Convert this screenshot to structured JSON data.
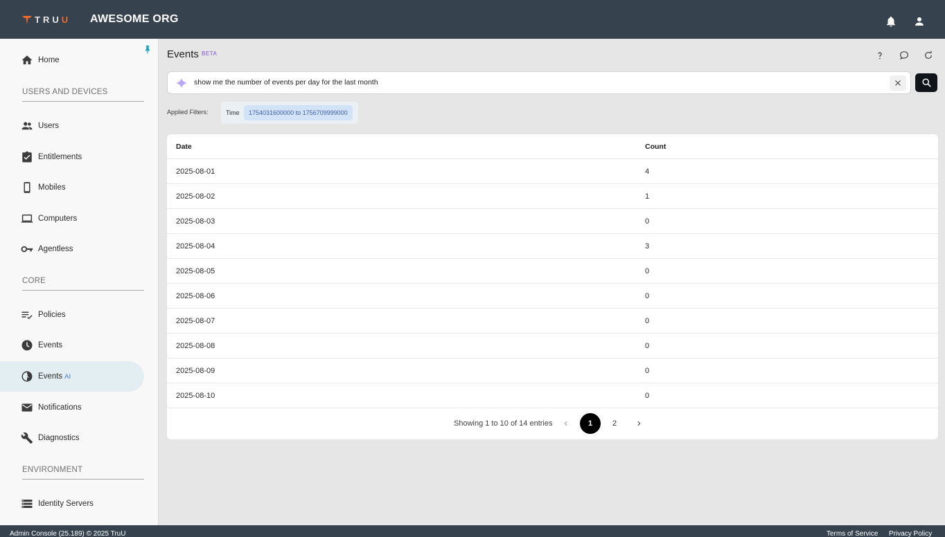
{
  "header": {
    "logo_text_a": "TRU",
    "logo_text_b": "U",
    "org_name": "AWESOME ORG"
  },
  "sidebar": {
    "items": [
      {
        "label": "Home",
        "icon": "home-icon"
      },
      {
        "label": "Users",
        "icon": "users-icon"
      },
      {
        "label": "Entitlements",
        "icon": "clipboard-check-icon"
      },
      {
        "label": "Mobiles",
        "icon": "mobile-icon"
      },
      {
        "label": "Computers",
        "icon": "laptop-icon"
      },
      {
        "label": "Agentless",
        "icon": "key-icon"
      },
      {
        "label": "Policies",
        "icon": "policy-list-icon"
      },
      {
        "label": "Events",
        "icon": "clock-icon"
      },
      {
        "label": "Events",
        "badge": "AI",
        "icon": "clock-ai-icon"
      },
      {
        "label": "Notifications",
        "icon": "mail-icon"
      },
      {
        "label": "Diagnostics",
        "icon": "wrench-icon"
      },
      {
        "label": "Identity Servers",
        "icon": "server-icon"
      }
    ],
    "sections": {
      "users_devices": "USERS AND DEVICES",
      "core": "CORE",
      "environment": "ENVIRONMENT"
    }
  },
  "main": {
    "title": "Events",
    "badge": "BETA",
    "search": {
      "value": "show me the number of events per day for the last month"
    },
    "filters": {
      "label": "Applied Filters:",
      "key": "Time",
      "value": "1754031600000 to 1756709999000"
    },
    "table": {
      "columns": [
        "Date",
        "Count"
      ],
      "rows": [
        [
          "2025-08-01",
          "4"
        ],
        [
          "2025-08-02",
          "1"
        ],
        [
          "2025-08-03",
          "0"
        ],
        [
          "2025-08-04",
          "3"
        ],
        [
          "2025-08-05",
          "0"
        ],
        [
          "2025-08-06",
          "0"
        ],
        [
          "2025-08-07",
          "0"
        ],
        [
          "2025-08-08",
          "0"
        ],
        [
          "2025-08-09",
          "0"
        ],
        [
          "2025-08-10",
          "0"
        ]
      ]
    },
    "pagination": {
      "info": "Showing 1 to 10 of 14 entries",
      "pages": [
        "1",
        "2"
      ],
      "current": "1"
    }
  },
  "footer": {
    "left": "Admin Console (25.189) © 2025 TruU",
    "terms": "Terms of Service",
    "privacy": "Privacy Policy"
  },
  "colors": {
    "topbar": "#36434f",
    "accent_orange": "#f06a2b",
    "active_nav": "#e3eef2",
    "chip": "#d2e3f7"
  }
}
